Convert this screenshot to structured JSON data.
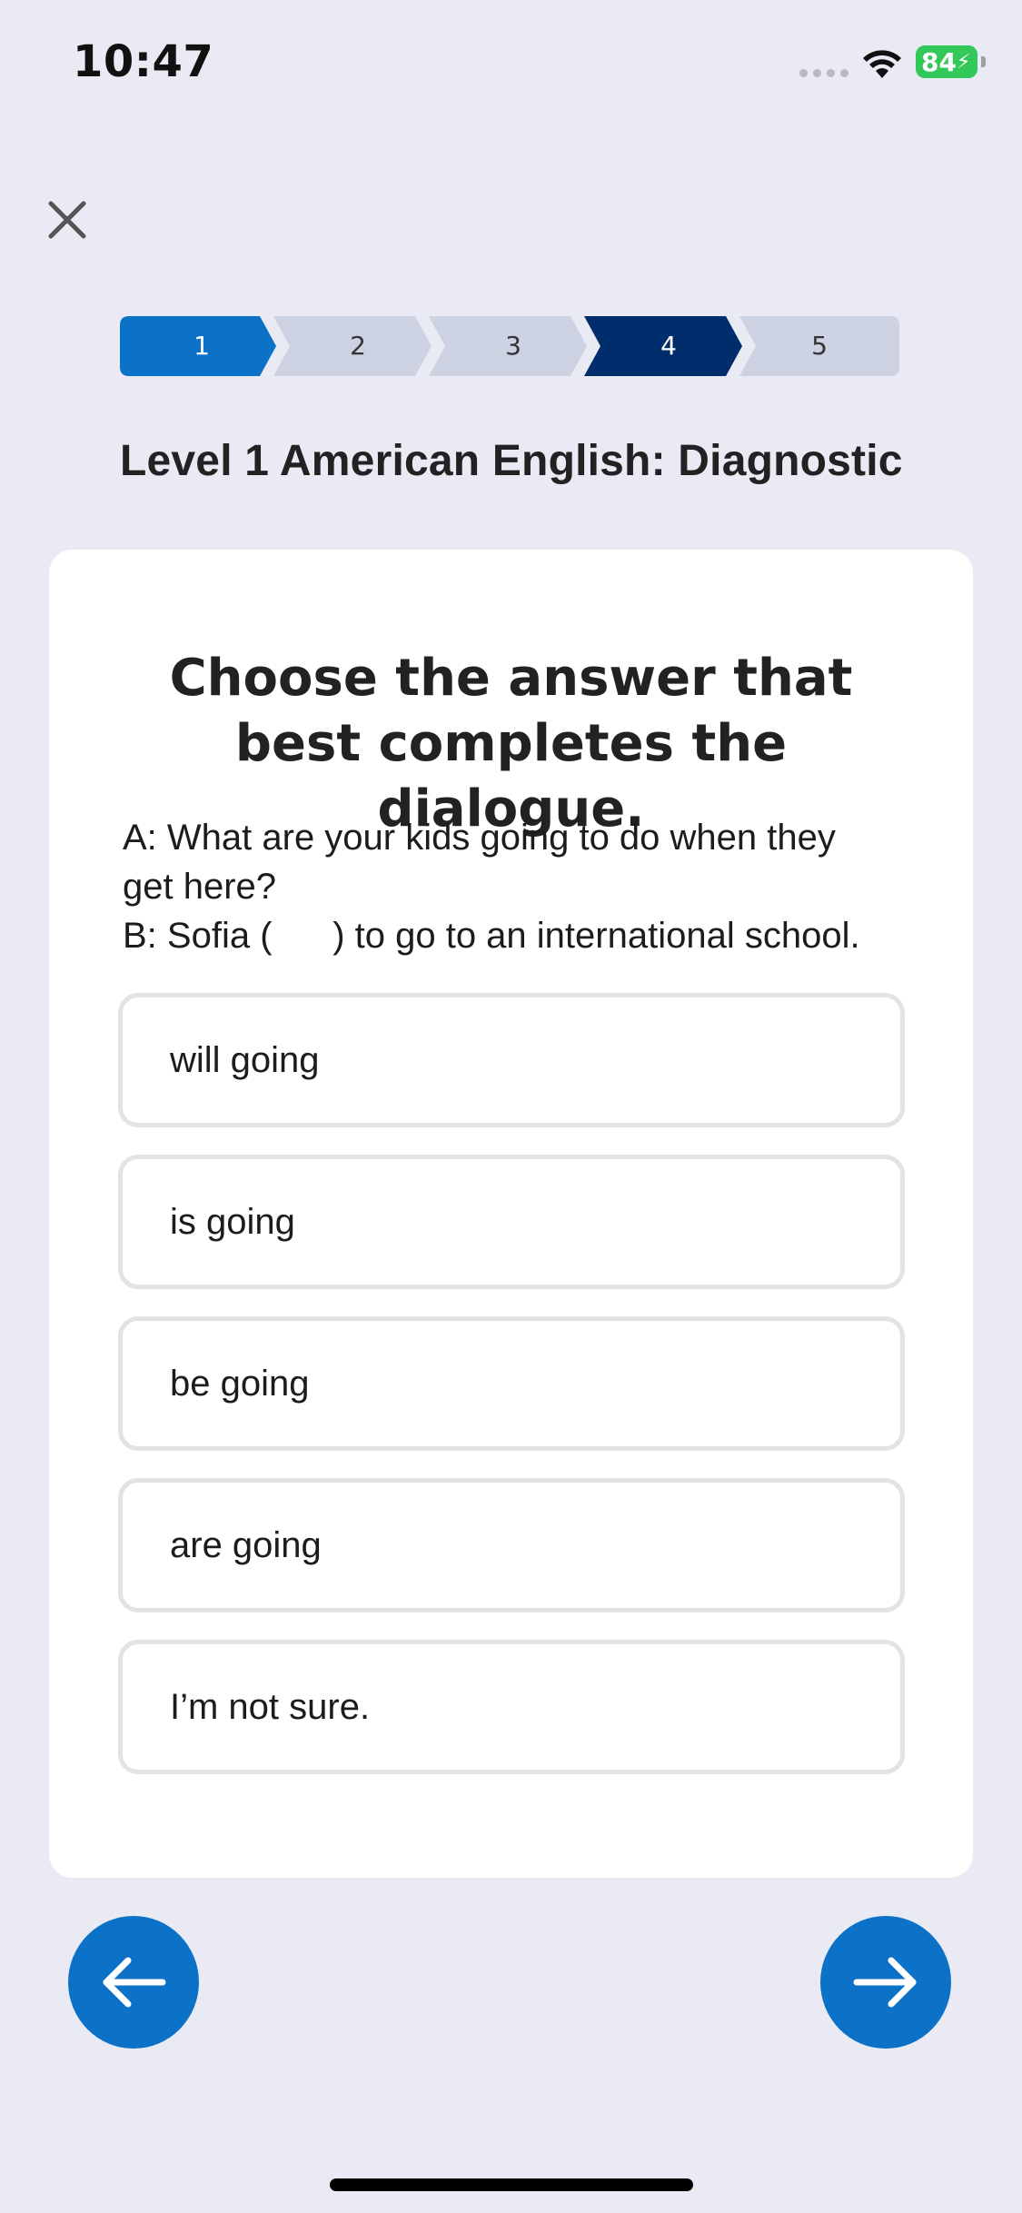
{
  "status_bar": {
    "time": "10:47",
    "battery": "84"
  },
  "header": {
    "close_icon": "close-icon"
  },
  "stepper": {
    "steps": [
      "1",
      "2",
      "3",
      "4",
      "5"
    ],
    "colors": {
      "completed": "#0b72c8",
      "current": "#002d6b",
      "pending": "#cdd2e3"
    }
  },
  "page": {
    "title": "Level 1 American English: Diagnostic"
  },
  "question": {
    "heading": "Choose the answer that best completes the dialogue.",
    "dialogue_lines": [
      "A: What are your kids going to do when they",
      "get here?",
      "B: Sofia (      ) to go to an international school."
    ],
    "options": [
      "will going",
      "is going",
      "be going",
      "are going",
      "I’m not sure."
    ]
  },
  "navigation": {
    "back_icon": "arrow-left-icon",
    "next_icon": "arrow-right-icon",
    "accent": "#0b72c8"
  }
}
